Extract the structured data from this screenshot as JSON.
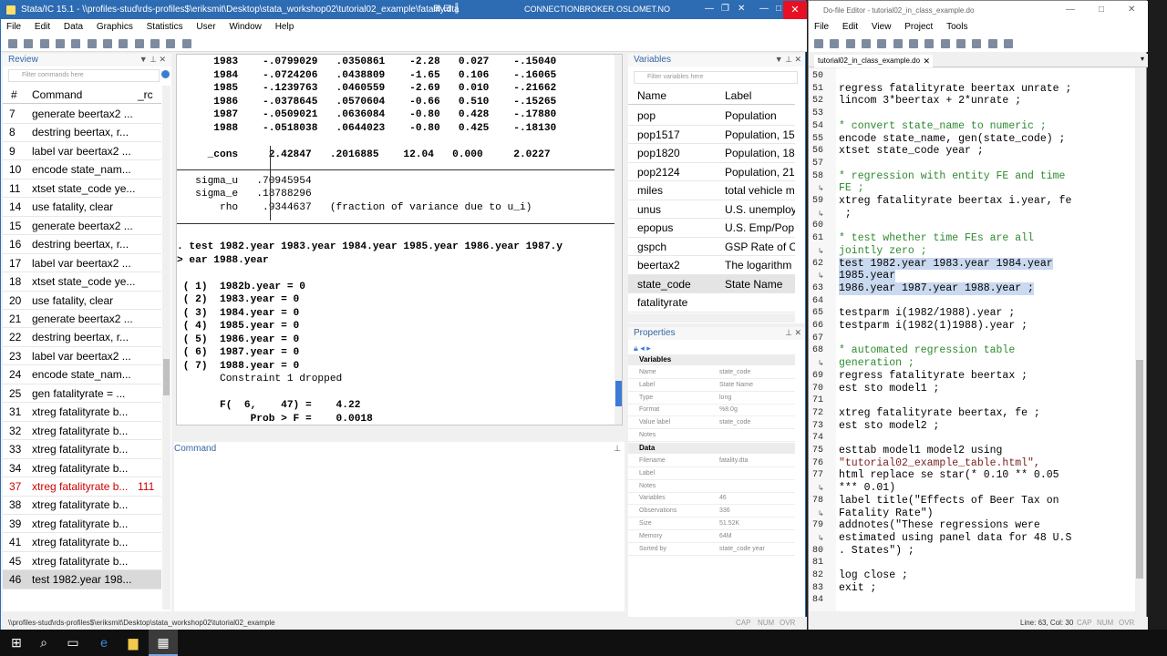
{
  "stata": {
    "title": "Stata/IC 15.1 - \\\\profiles-stud\\rds-profiles$\\eriksmit\\Desktop\\stata_workshop02\\tutorial02_example\\fatality.dta",
    "connection": "CONNECTIONBROKER.OSLOMET.NO",
    "menu": [
      "File",
      "Edit",
      "Data",
      "Graphics",
      "Statistics",
      "User",
      "Window",
      "Help"
    ],
    "status_path": "\\\\profiles-stud\\rds-profiles$\\eriksmit\\Desktop\\stata_workshop02\\tutorial02_example",
    "status_flags": [
      "CAP",
      "NUM",
      "OVR"
    ]
  },
  "review": {
    "title": "Review",
    "filter_placeholder": "Filter commands here",
    "col_num": "#",
    "col_cmd": "Command",
    "col_rc": "_rc",
    "rows": [
      {
        "n": "7",
        "cmd": "generate beertax2 ...",
        "rc": ""
      },
      {
        "n": "8",
        "cmd": "destring beertax, r...",
        "rc": ""
      },
      {
        "n": "9",
        "cmd": "label var beertax2 ...",
        "rc": ""
      },
      {
        "n": "10",
        "cmd": "encode state_nam...",
        "rc": ""
      },
      {
        "n": "11",
        "cmd": "xtset state_code ye...",
        "rc": ""
      },
      {
        "n": "14",
        "cmd": "use fatality, clear",
        "rc": ""
      },
      {
        "n": "15",
        "cmd": "generate beertax2 ...",
        "rc": ""
      },
      {
        "n": "16",
        "cmd": "destring beertax, r...",
        "rc": ""
      },
      {
        "n": "17",
        "cmd": "label var beertax2 ...",
        "rc": ""
      },
      {
        "n": "18",
        "cmd": "xtset state_code ye...",
        "rc": ""
      },
      {
        "n": "20",
        "cmd": "use fatality, clear",
        "rc": ""
      },
      {
        "n": "21",
        "cmd": "generate beertax2 ...",
        "rc": ""
      },
      {
        "n": "22",
        "cmd": "destring beertax, r...",
        "rc": ""
      },
      {
        "n": "23",
        "cmd": "label var beertax2 ...",
        "rc": ""
      },
      {
        "n": "24",
        "cmd": "encode state_nam...",
        "rc": ""
      },
      {
        "n": "25",
        "cmd": "gen fatalityrate = ...",
        "rc": ""
      },
      {
        "n": "31",
        "cmd": "xtreg fatalityrate b...",
        "rc": ""
      },
      {
        "n": "32",
        "cmd": "xtreg fatalityrate b...",
        "rc": ""
      },
      {
        "n": "33",
        "cmd": "xtreg fatalityrate b...",
        "rc": ""
      },
      {
        "n": "34",
        "cmd": "xtreg fatalityrate b...",
        "rc": ""
      },
      {
        "n": "37",
        "cmd": "xtreg fatalityrate b...",
        "rc": "111"
      },
      {
        "n": "38",
        "cmd": "xtreg fatalityrate b...",
        "rc": ""
      },
      {
        "n": "39",
        "cmd": "xtreg fatalityrate b...",
        "rc": ""
      },
      {
        "n": "41",
        "cmd": "xtreg fatalityrate b...",
        "rc": ""
      },
      {
        "n": "45",
        "cmd": "xtreg fatalityrate b...",
        "rc": ""
      },
      {
        "n": "46",
        "cmd": "test 1982.year 198...",
        "rc": ""
      }
    ]
  },
  "results": {
    "lines": [
      "      1983    -.0799029   .0350861    -2.28   0.027    -.15040",
      "      1984    -.0724206   .0438809    -1.65   0.106    -.16065",
      "      1985    -.1239763   .0460559    -2.69   0.010    -.21662",
      "      1986    -.0378645   .0570604    -0.66   0.510    -.15265",
      "      1987    -.0509021   .0636084    -0.80   0.428    -.17880",
      "      1988    -.0518038   .0644023    -0.80   0.425    -.18130",
      "",
      "     _cons     2.42847   .2016885    12.04   0.000     2.0227",
      "",
      "   sigma_u   .70945954",
      "   sigma_e   .18788296",
      "       rho    .9344637   (fraction of variance due to u_i)",
      "",
      "",
      ". test 1982.year 1983.year 1984.year 1985.year 1986.year 1987.y",
      "> ear 1988.year",
      "",
      " ( 1)  1982b.year = 0",
      " ( 2)  1983.year = 0",
      " ( 3)  1984.year = 0",
      " ( 4)  1985.year = 0",
      " ( 5)  1986.year = 0",
      " ( 6)  1987.year = 0",
      " ( 7)  1988.year = 0",
      "       Constraint 1 dropped",
      "",
      "       F(  6,    47) =    4.22",
      "            Prob > F =    0.0018"
    ]
  },
  "command": {
    "title": "Command"
  },
  "variables": {
    "title": "Variables",
    "filter_placeholder": "Filter variables here",
    "col_name": "Name",
    "col_label": "Label",
    "rows": [
      {
        "name": "pop",
        "label": "Population"
      },
      {
        "name": "pop1517",
        "label": "Population, 15"
      },
      {
        "name": "pop1820",
        "label": "Population, 18"
      },
      {
        "name": "pop2124",
        "label": "Population, 21"
      },
      {
        "name": "miles",
        "label": "total vehicle m"
      },
      {
        "name": "unus",
        "label": "U.S. unemploy"
      },
      {
        "name": "epopus",
        "label": "U.S. Emp/Pop"
      },
      {
        "name": "gspch",
        "label": "GSP Rate of C"
      },
      {
        "name": "beertax2",
        "label": "The logarithm"
      },
      {
        "name": "state_code",
        "label": "State Name"
      },
      {
        "name": "fatalityrate",
        "label": ""
      }
    ]
  },
  "properties": {
    "title": "Properties",
    "section_vars": "Variables",
    "vars": [
      {
        "k": "Name",
        "v": "state_code"
      },
      {
        "k": "Label",
        "v": "State Name"
      },
      {
        "k": "Type",
        "v": "long"
      },
      {
        "k": "Format",
        "v": "%8.0g"
      },
      {
        "k": "Value label",
        "v": "state_code"
      },
      {
        "k": "Notes",
        "v": ""
      }
    ],
    "section_data": "Data",
    "data": [
      {
        "k": "Filename",
        "v": "fatality.dta"
      },
      {
        "k": "Label",
        "v": ""
      },
      {
        "k": "Notes",
        "v": ""
      },
      {
        "k": "Variables",
        "v": "46"
      },
      {
        "k": "Observations",
        "v": "336"
      },
      {
        "k": "Size",
        "v": "51.52K"
      },
      {
        "k": "Memory",
        "v": "64M"
      },
      {
        "k": "Sorted by",
        "v": "state_code  year"
      }
    ]
  },
  "dofile": {
    "title": "Do-file Editor - tutorial02_in_class_example.do",
    "menu": [
      "File",
      "Edit",
      "View",
      "Project",
      "Tools"
    ],
    "tab": "tutorial02_in_class_example.do",
    "status": "Line: 63, Col: 30",
    "status_flags": [
      "CAP",
      "NUM",
      "OVR"
    ],
    "lines": [
      {
        "n": "50",
        "t": "",
        "c": ""
      },
      {
        "n": "51",
        "t": "regress fatalityrate beertax unrate ;",
        "c": ""
      },
      {
        "n": "52",
        "t": "lincom 3*beertax + 2*unrate ;",
        "c": ""
      },
      {
        "n": "53",
        "t": "",
        "c": ""
      },
      {
        "n": "54",
        "t": "* convert state_name to numeric ;",
        "c": "cmt"
      },
      {
        "n": "55",
        "t": "encode state_name, gen(state_code) ;",
        "c": ""
      },
      {
        "n": "56",
        "t": "xtset state_code year ;",
        "c": ""
      },
      {
        "n": "57",
        "t": "",
        "c": ""
      },
      {
        "n": "58",
        "t": "* regression with entity FE and time",
        "c": "cmt"
      },
      {
        "n": "",
        "t": "FE ;",
        "c": "cmt"
      },
      {
        "n": "59",
        "t": "xtreg fatalityrate beertax i.year, fe",
        "c": ""
      },
      {
        "n": "",
        "t": " ;",
        "c": ""
      },
      {
        "n": "60",
        "t": "",
        "c": ""
      },
      {
        "n": "61",
        "t": "* test whether time FEs are all",
        "c": "cmt"
      },
      {
        "n": "",
        "t": "jointly zero ;",
        "c": "cmt"
      },
      {
        "n": "62",
        "t": "test 1982.year 1983.year 1984.year",
        "c": "sel"
      },
      {
        "n": "",
        "t": "1985.year",
        "c": "sel"
      },
      {
        "n": "63",
        "t": "1986.year 1987.year 1988.year ;",
        "c": "sel"
      },
      {
        "n": "64",
        "t": "",
        "c": ""
      },
      {
        "n": "65",
        "t": "testparm i(1982/1988).year ;",
        "c": ""
      },
      {
        "n": "66",
        "t": "testparm i(1982(1)1988).year ;",
        "c": ""
      },
      {
        "n": "67",
        "t": "",
        "c": ""
      },
      {
        "n": "68",
        "t": "* automated regression table",
        "c": "cmt"
      },
      {
        "n": "",
        "t": "generation ;",
        "c": "cmt"
      },
      {
        "n": "69",
        "t": "regress fatalityrate beertax ;",
        "c": ""
      },
      {
        "n": "70",
        "t": "est sto model1 ;",
        "c": ""
      },
      {
        "n": "71",
        "t": "",
        "c": ""
      },
      {
        "n": "72",
        "t": "xtreg fatalityrate beertax, fe ;",
        "c": ""
      },
      {
        "n": "73",
        "t": "est sto model2 ;",
        "c": ""
      },
      {
        "n": "74",
        "t": "",
        "c": ""
      },
      {
        "n": "75",
        "t": "esttab model1 model2 using",
        "c": ""
      },
      {
        "n": "76",
        "t": "\"tutorial02_example_table.html\",",
        "c": "str"
      },
      {
        "n": "77",
        "t": "html replace se star(* 0.10 ** 0.05",
        "c": ""
      },
      {
        "n": "",
        "t": "*** 0.01)",
        "c": ""
      },
      {
        "n": "78",
        "t": "label title(\"Effects of Beer Tax on",
        "c": ""
      },
      {
        "n": "",
        "t": "Fatality Rate\")",
        "c": ""
      },
      {
        "n": "79",
        "t": "addnotes(\"These regressions were",
        "c": ""
      },
      {
        "n": "",
        "t": "estimated using panel data for 48 U.S",
        "c": ""
      },
      {
        "n": "80",
        "t": ". States\") ;",
        "c": ""
      },
      {
        "n": "81",
        "t": "",
        "c": ""
      },
      {
        "n": "82",
        "t": "log close ;",
        "c": ""
      },
      {
        "n": "83",
        "t": "exit ;",
        "c": ""
      },
      {
        "n": "84",
        "t": "",
        "c": ""
      }
    ]
  },
  "taskbar": {
    "icons": [
      "windows-icon",
      "search-icon",
      "task-view-icon",
      "edge-icon",
      "file-explorer-icon",
      "stata-icon"
    ]
  }
}
